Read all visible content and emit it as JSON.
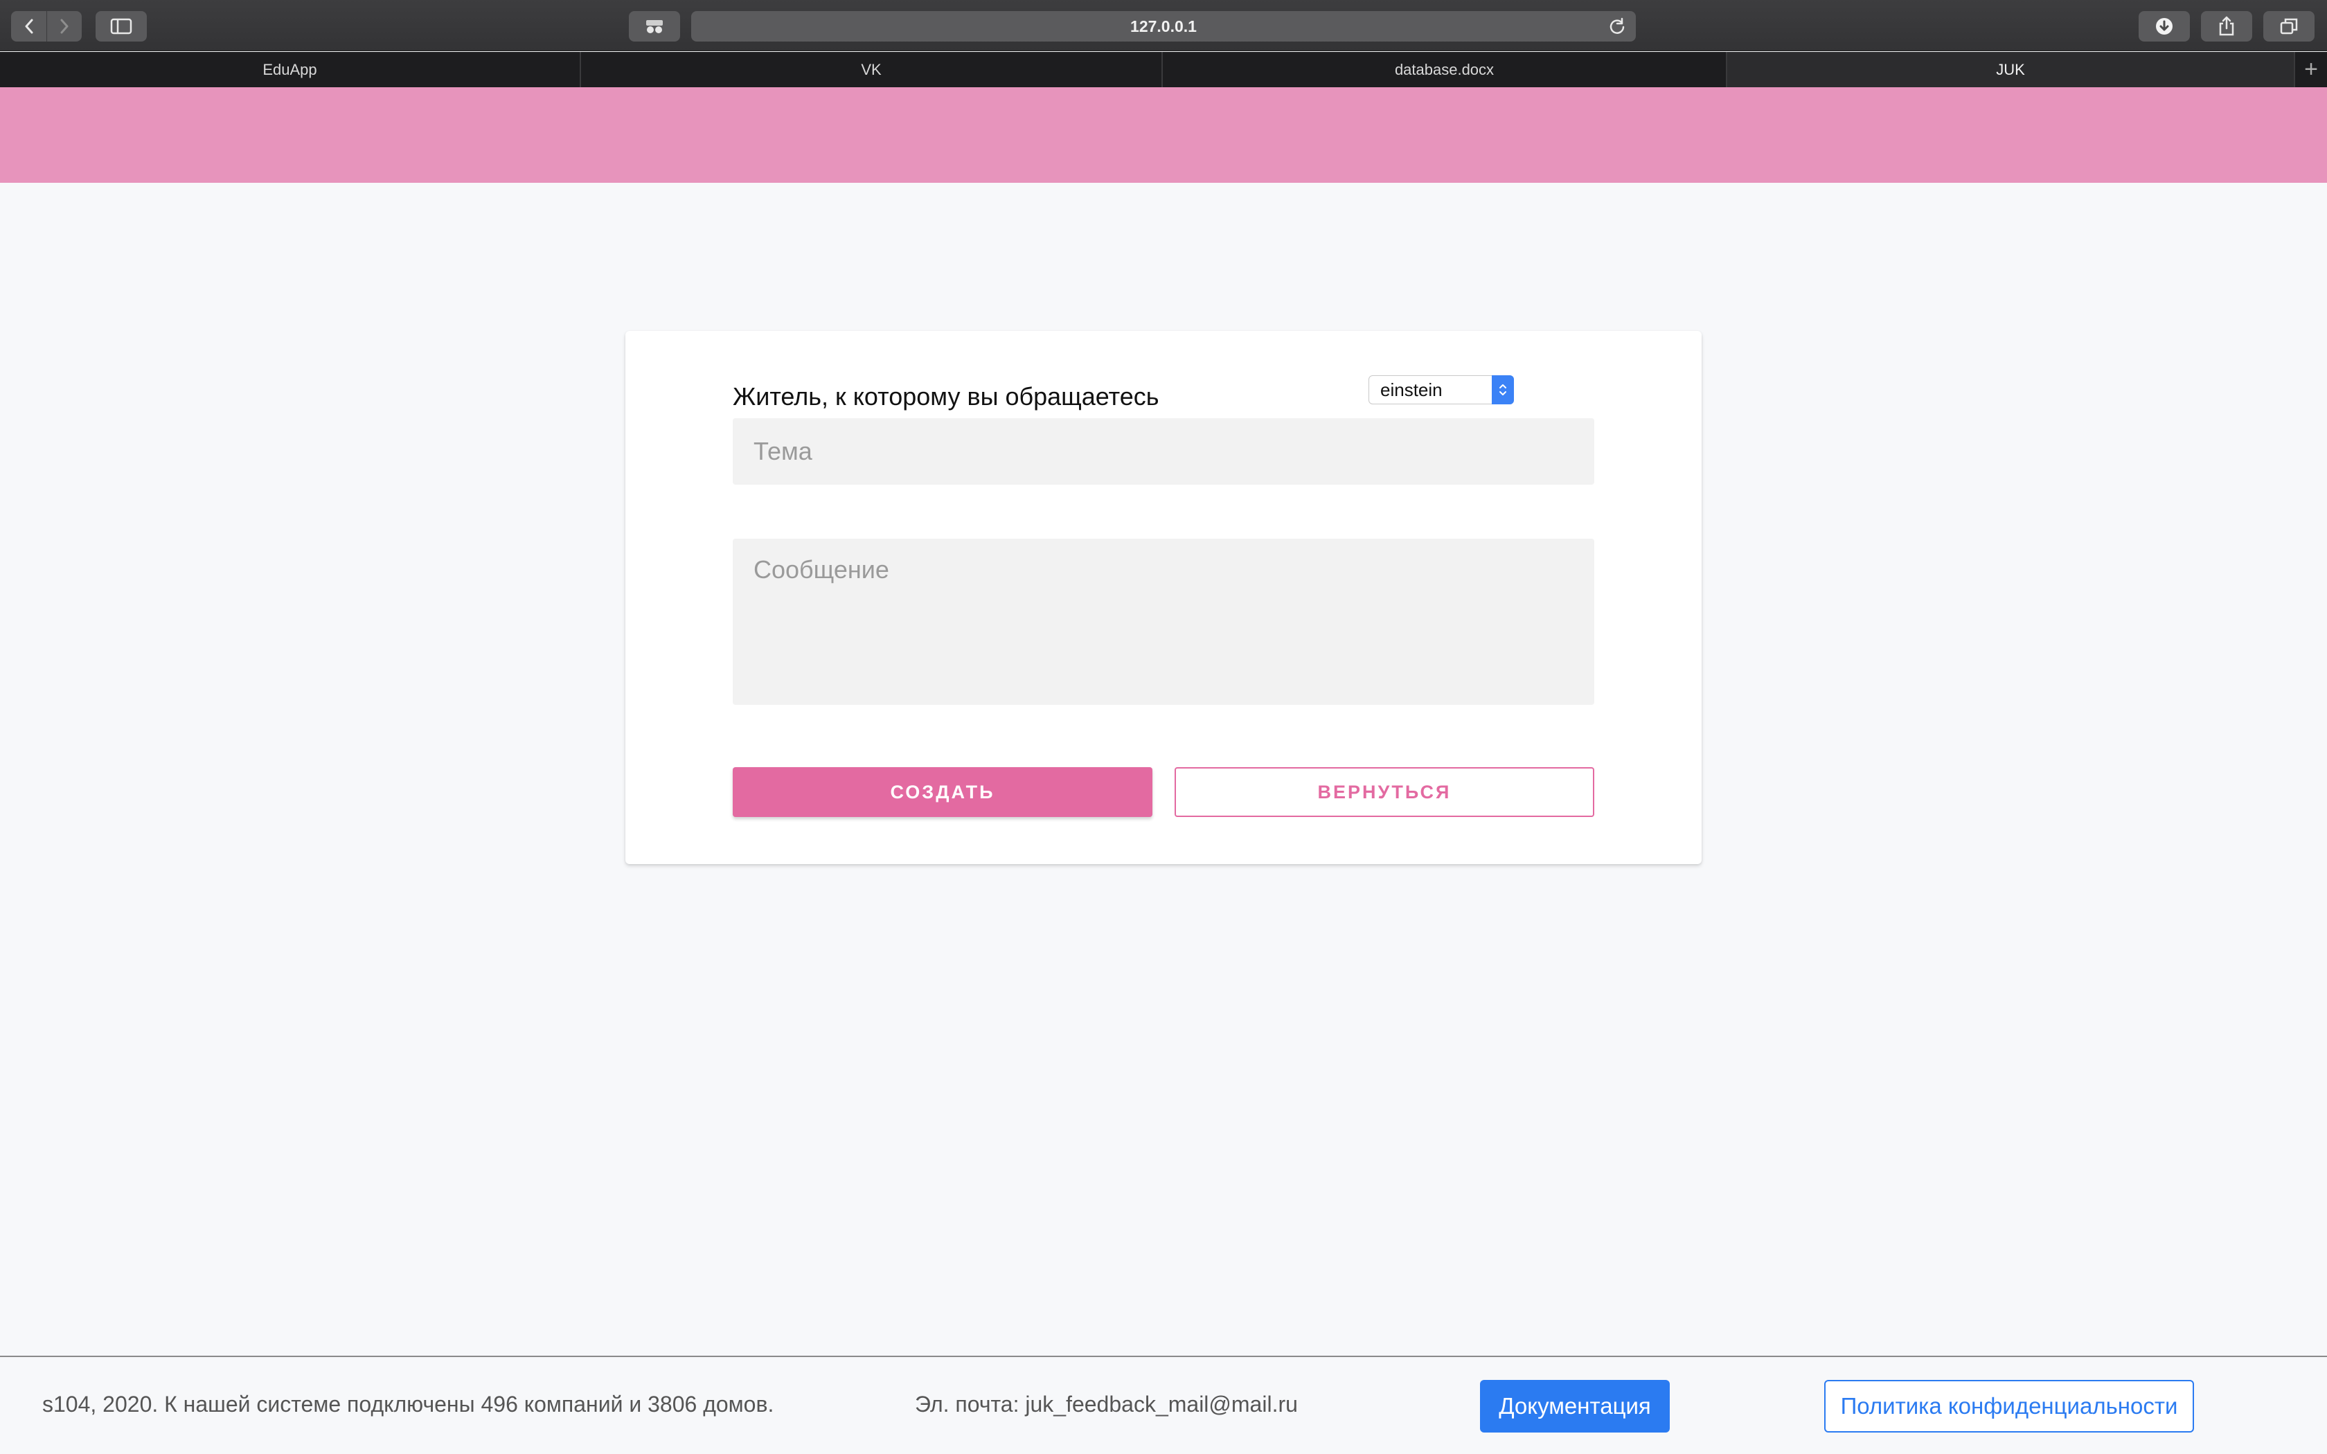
{
  "browser": {
    "address": "127.0.0.1",
    "tabs": [
      {
        "label": "EduApp",
        "active": false
      },
      {
        "label": "VK",
        "active": false
      },
      {
        "label": "database.docx",
        "active": false
      },
      {
        "label": "JUK",
        "active": true
      }
    ],
    "tab_add": "+"
  },
  "form": {
    "recipient_label": "Житель, к которому вы обращаетесь",
    "recipient_value": "einstein",
    "subject_placeholder": "Тема",
    "message_placeholder": "Сообщение",
    "create_label": "СОЗДАТЬ",
    "back_label": "ВЕРНУТЬСЯ"
  },
  "footer": {
    "info": "s104, 2020. К нашей системе подключены 496 компаний и 3806 домов.",
    "email": "Эл. почта: juk_feedback_mail@mail.ru",
    "docs_label": "Документация",
    "policy_label": "Политика конфиденциальности"
  },
  "colors": {
    "header_pink": "#e794bc",
    "accent_pink": "#e36aa1",
    "accent_blue": "#2b7bf1"
  }
}
